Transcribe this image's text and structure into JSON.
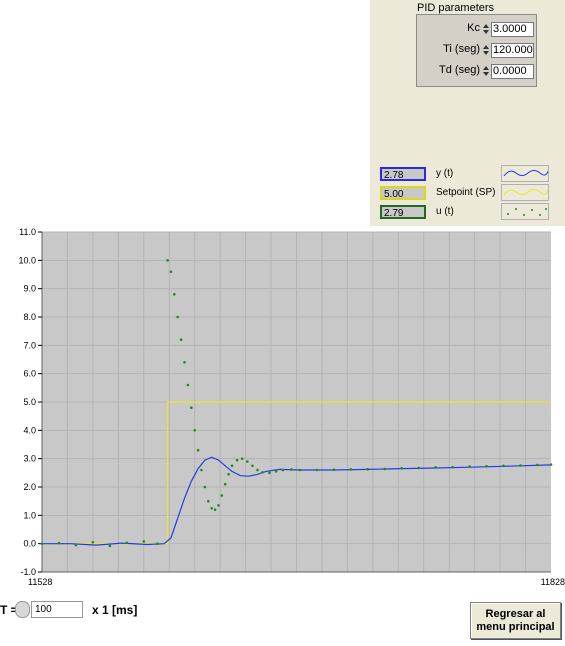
{
  "pid": {
    "title": "PID parameters",
    "rows": [
      {
        "label": "Kc",
        "value": "3.0000"
      },
      {
        "label": "Ti (seg)",
        "value": "120.0000"
      },
      {
        "label": "Td (seg)",
        "value": "0.0000"
      }
    ]
  },
  "legend": [
    {
      "indicator": "2.78",
      "label": "y (t)",
      "color": "#1f3fe0",
      "style": "line"
    },
    {
      "indicator": "5.00",
      "label": "Setpoint (SP)",
      "color": "#e8e82a",
      "style": "line"
    },
    {
      "indicator": "2.79",
      "label": "u (t)",
      "color": "#1f8a1f",
      "style": "dots"
    }
  ],
  "controls": {
    "dt_label": "T =",
    "dt_value": "100",
    "dt_unit": "x 1 [ms]",
    "back_button": "Regresar al menu principal"
  },
  "chart_data": {
    "type": "line",
    "title": "",
    "xlabel": "",
    "ylabel": "",
    "xlim": [
      11528,
      11828
    ],
    "ylim": [
      -1.0,
      11.0
    ],
    "x_ticks": [
      "11528",
      "11828"
    ],
    "y_ticks": [
      "11.0",
      "10.0",
      "9.0",
      "8.0",
      "7.0",
      "6.0",
      "5.0",
      "4.0",
      "3.0",
      "2.0",
      "1.0",
      "0.0",
      "-1.0"
    ],
    "grid": true,
    "background": "#c8c8c8",
    "series": [
      {
        "name": "Setpoint (SP)",
        "color": "#e8e82a",
        "style": "line",
        "x": [
          11528,
          11602,
          11602,
          11828
        ],
        "y": [
          0.0,
          0.0,
          5.0,
          5.0
        ]
      },
      {
        "name": "y (t)",
        "color": "#1f3fe0",
        "style": "line",
        "x": [
          11528,
          11545,
          11560,
          11575,
          11590,
          11600,
          11604,
          11608,
          11612,
          11616,
          11620,
          11624,
          11628,
          11632,
          11636,
          11640,
          11645,
          11650,
          11655,
          11660,
          11668,
          11680,
          11700,
          11720,
          11740,
          11760,
          11780,
          11800,
          11828
        ],
        "y": [
          0.0,
          0.0,
          -0.05,
          0.02,
          -0.03,
          0.0,
          0.2,
          0.9,
          1.6,
          2.2,
          2.65,
          2.95,
          3.05,
          2.95,
          2.75,
          2.55,
          2.4,
          2.38,
          2.45,
          2.55,
          2.62,
          2.6,
          2.6,
          2.62,
          2.65,
          2.67,
          2.7,
          2.73,
          2.78
        ]
      },
      {
        "name": "u (t)",
        "color": "#1f8a1f",
        "style": "dots",
        "x": [
          11528,
          11538,
          11548,
          11558,
          11568,
          11578,
          11588,
          11596,
          11602,
          11604,
          11606,
          11608,
          11610,
          11612,
          11614,
          11616,
          11618,
          11620,
          11622,
          11624,
          11626,
          11628,
          11630,
          11632,
          11634,
          11636,
          11638,
          11640,
          11643,
          11646,
          11649,
          11652,
          11655,
          11658,
          11662,
          11666,
          11670,
          11675,
          11680,
          11690,
          11700,
          11710,
          11720,
          11730,
          11740,
          11750,
          11760,
          11770,
          11780,
          11790,
          11800,
          11810,
          11820,
          11828
        ],
        "y": [
          0.0,
          0.02,
          -0.05,
          0.05,
          -0.08,
          0.03,
          0.08,
          0.0,
          10.0,
          9.6,
          8.8,
          8.0,
          7.2,
          6.4,
          5.6,
          4.8,
          4.0,
          3.3,
          2.6,
          2.0,
          1.5,
          1.25,
          1.2,
          1.35,
          1.7,
          2.1,
          2.45,
          2.75,
          2.95,
          3.0,
          2.9,
          2.75,
          2.6,
          2.52,
          2.5,
          2.55,
          2.6,
          2.62,
          2.6,
          2.6,
          2.61,
          2.62,
          2.63,
          2.64,
          2.66,
          2.67,
          2.69,
          2.7,
          2.72,
          2.73,
          2.75,
          2.76,
          2.78,
          2.79
        ]
      }
    ]
  }
}
